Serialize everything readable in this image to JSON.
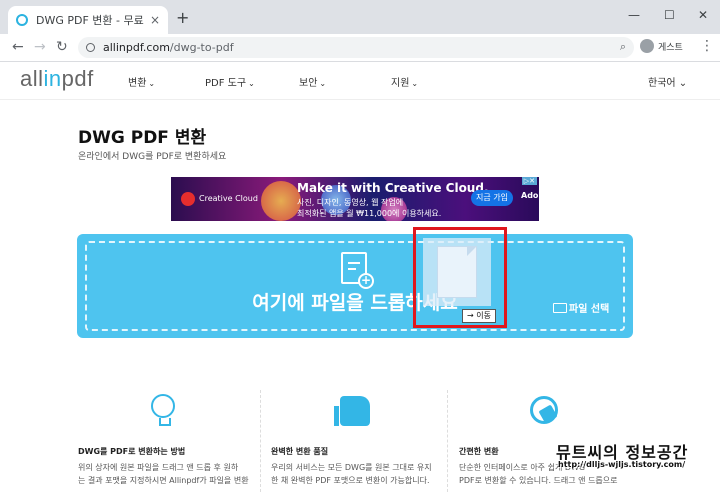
{
  "browser": {
    "tab_title": "DWG PDF 변환 - 무료 온라인 D",
    "tab_close": "×",
    "new_tab": "+",
    "min": "—",
    "max": "☐",
    "close": "✕",
    "back": "←",
    "forward": "→",
    "reload": "↻",
    "url_host": "allinpdf.com",
    "url_path": "/dwg-to-pdf",
    "zoom_icon": "⌕",
    "profile_label": "게스트",
    "menu": "⋮"
  },
  "site": {
    "logo_pre": "all",
    "logo_in": "in",
    "logo_post": "pdf",
    "nav": [
      "변환",
      "PDF 도구",
      "보안",
      "지원"
    ],
    "caret": "⌄",
    "lang": "한국어",
    "lang_caret": "⌄"
  },
  "page": {
    "title": "DWG PDF 변환",
    "subtitle": "온라인에서 DWG를 PDF로 변환하세요"
  },
  "ad": {
    "brand": "Creative Cloud",
    "headline": "Make it with Creative Cloud.",
    "line1": "사진, 디자인, 동영상, 웹 작업에",
    "line2": "최적화된 앱을 월 ₩11,000에 이용하세요.",
    "cta": "지금 가입",
    "adobe": "Adobe",
    "ad_mark": "▷✕"
  },
  "dropzone": {
    "text": "여기에 파일을 드롭하세요",
    "choose_label": "파일 선택",
    "plus": "+"
  },
  "drag": {
    "tooltip": "→ 이동"
  },
  "features": [
    {
      "title": "DWG를 PDF로 변환하는 방법",
      "line1": "위의 상자에 원본 파일을 드래그 앤 드롭 후 원하",
      "line2": "는 결과 포맷을 지정하시면 Allinpdf가 파일을 변환"
    },
    {
      "title": "완벽한 변환 품질",
      "line1": "우리의 서비스는 모든 DWG를 원본 그대로 유지",
      "line2": "한 채 완벽한 PDF 포맷으로 변환이 가능합니다."
    },
    {
      "title": "간편한 변환",
      "line1": "단순한 인터페이스로 아주 쉽게 DWG",
      "line2": "PDF로 변환할 수 있습니다. 드래그 앤 드롭으로"
    }
  ],
  "watermark": {
    "title": "뮤트씨의 정보공간",
    "url": "http://dlljs-wjljs.tistory.com/"
  }
}
